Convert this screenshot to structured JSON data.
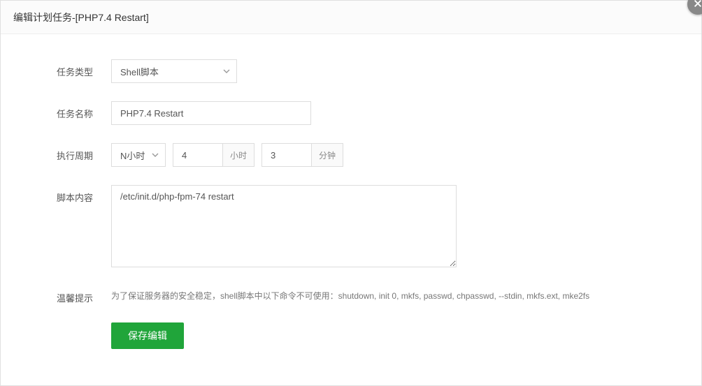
{
  "modal": {
    "title": "编辑计划任务-[PHP7.4 Restart]"
  },
  "form": {
    "task_type": {
      "label": "任务类型",
      "value": "Shell脚本"
    },
    "task_name": {
      "label": "任务名称",
      "value": "PHP7.4 Restart"
    },
    "cycle": {
      "label": "执行周期",
      "period_value": "N小时",
      "hour_value": "4",
      "hour_suffix": "小时",
      "minute_value": "3",
      "minute_suffix": "分钟"
    },
    "script": {
      "label": "脚本内容",
      "value": "/etc/init.d/php-fpm-74 restart"
    },
    "tip": {
      "label": "温馨提示",
      "text": "为了保证服务器的安全稳定，shell脚本中以下命令不可使用：shutdown, init 0, mkfs, passwd, chpasswd, --stdin, mkfs.ext, mke2fs"
    },
    "save_label": "保存编辑"
  }
}
